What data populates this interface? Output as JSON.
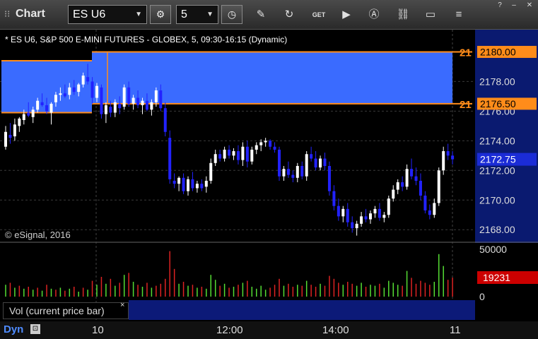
{
  "toolbar": {
    "title": "Chart",
    "symbol": "ES U6",
    "interval": "5"
  },
  "chart": {
    "header": "* ES U6, S&P 500 E-MINI FUTURES - GLOBEX, 5, 09:30-16:15 (Dynamic)",
    "copyright": "© eSignal, 2016",
    "price_labels": [
      "2178.00",
      "2176.00",
      "2174.00",
      "2172.00",
      "2170.00",
      "2168.00"
    ],
    "level_high": "2180.00",
    "level_low": "2176.50",
    "level_high_short": "21",
    "level_low_short": "21",
    "last_price": "2172.75",
    "volume_labels": [
      "50000",
      "0"
    ],
    "volume_current": "19231",
    "volume_title": "Vol (current price bar)",
    "volume_close": "×",
    "time_labels": [
      "10",
      "12:00",
      "14:00",
      "11"
    ],
    "footer_mode": "Dyn"
  },
  "colors": {
    "zone": "#3a6bff",
    "level": "#ff8c1a",
    "down_bar": "#2222ff",
    "up_bar": "#ffffff",
    "price_tag_bg": "#1b2cd6",
    "volume_tag_bg": "#cc0000",
    "vol_up": "#55dd33",
    "vol_down": "#dd2222"
  },
  "chart_data": {
    "type": "candlestick",
    "price_range": [
      2167.2,
      2181.5
    ],
    "volume_range": [
      0,
      50000
    ],
    "candles": [
      [
        2173.6,
        2175.0,
        2173.4,
        2174.6
      ],
      [
        2174.4,
        2175.2,
        2173.8,
        2174.2
      ],
      [
        2174.3,
        2175.5,
        2174.0,
        2175.1
      ],
      [
        2175.0,
        2175.6,
        2174.6,
        2175.5
      ],
      [
        2175.4,
        2176.1,
        2175.1,
        2175.8
      ],
      [
        2175.9,
        2176.6,
        2175.6,
        2175.7
      ],
      [
        2175.6,
        2176.3,
        2175.2,
        2176.1
      ],
      [
        2176.1,
        2176.9,
        2175.9,
        2176.7
      ],
      [
        2176.6,
        2177.2,
        2176.3,
        2176.4
      ],
      [
        2176.4,
        2176.9,
        2175.8,
        2176.0
      ],
      [
        2175.9,
        2176.6,
        2175.1,
        2176.5
      ],
      [
        2176.6,
        2177.3,
        2176.3,
        2177.1
      ],
      [
        2177.1,
        2177.6,
        2176.7,
        2177.2
      ],
      [
        2177.2,
        2177.8,
        2176.9,
        2177.0
      ],
      [
        2177.1,
        2177.9,
        2176.8,
        2177.6
      ],
      [
        2177.6,
        2178.1,
        2177.1,
        2177.3
      ],
      [
        2177.3,
        2177.9,
        2177.0,
        2177.8
      ],
      [
        2177.8,
        2178.6,
        2177.6,
        2178.4
      ],
      [
        2178.3,
        2179.2,
        2177.8,
        2178.0
      ],
      [
        2178.0,
        2178.3,
        2176.5,
        2176.9
      ],
      [
        2176.9,
        2177.9,
        2176.6,
        2177.7
      ],
      [
        2177.6,
        2177.8,
        2175.5,
        2175.8
      ],
      [
        2175.8,
        2176.6,
        2175.2,
        2176.4
      ],
      [
        2176.3,
        2176.7,
        2175.6,
        2175.9
      ],
      [
        2175.9,
        2176.8,
        2175.6,
        2176.6
      ],
      [
        2176.5,
        2177.0,
        2175.8,
        2176.2
      ],
      [
        2176.3,
        2177.8,
        2176.1,
        2177.6
      ],
      [
        2177.6,
        2178.0,
        2176.3,
        2176.5
      ],
      [
        2176.5,
        2177.1,
        2176.1,
        2176.9
      ],
      [
        2176.9,
        2177.4,
        2176.2,
        2176.4
      ],
      [
        2176.4,
        2176.9,
        2175.8,
        2176.7
      ],
      [
        2176.7,
        2177.2,
        2176.0,
        2176.1
      ],
      [
        2176.1,
        2176.8,
        2175.7,
        2176.6
      ],
      [
        2176.6,
        2177.6,
        2176.3,
        2177.4
      ],
      [
        2177.4,
        2177.8,
        2176.0,
        2176.2
      ],
      [
        2176.2,
        2176.6,
        2174.3,
        2174.6
      ],
      [
        2174.2,
        2174.7,
        2171.1,
        2171.4
      ],
      [
        2171.3,
        2171.8,
        2170.8,
        2171.1
      ],
      [
        2171.1,
        2171.6,
        2170.6,
        2171.5
      ],
      [
        2171.5,
        2171.8,
        2170.4,
        2170.6
      ],
      [
        2170.6,
        2171.6,
        2170.3,
        2171.4
      ],
      [
        2171.4,
        2171.9,
        2170.6,
        2170.8
      ],
      [
        2170.8,
        2171.3,
        2170.5,
        2171.1
      ],
      [
        2171.1,
        2171.4,
        2170.6,
        2170.8
      ],
      [
        2170.9,
        2171.6,
        2170.5,
        2171.3
      ],
      [
        2171.3,
        2172.8,
        2171.1,
        2172.5
      ],
      [
        2172.5,
        2173.4,
        2172.3,
        2173.1
      ],
      [
        2173.1,
        2173.4,
        2172.6,
        2172.8
      ],
      [
        2172.8,
        2173.6,
        2172.6,
        2173.4
      ],
      [
        2173.4,
        2173.7,
        2172.8,
        2173.0
      ],
      [
        2173.0,
        2173.5,
        2172.7,
        2173.3
      ],
      [
        2173.3,
        2173.7,
        2172.4,
        2172.7
      ],
      [
        2172.7,
        2173.9,
        2172.3,
        2173.6
      ],
      [
        2173.6,
        2174.0,
        2172.2,
        2172.6
      ],
      [
        2172.6,
        2173.6,
        2172.4,
        2173.4
      ],
      [
        2173.4,
        2173.9,
        2173.1,
        2173.7
      ],
      [
        2173.7,
        2174.1,
        2173.3,
        2173.9
      ],
      [
        2173.9,
        2174.2,
        2173.6,
        2174.0
      ],
      [
        2174.0,
        2174.1,
        2173.4,
        2173.6
      ],
      [
        2173.6,
        2173.9,
        2173.2,
        2173.4
      ],
      [
        2173.4,
        2173.6,
        2171.3,
        2171.6
      ],
      [
        2171.6,
        2172.3,
        2171.3,
        2172.1
      ],
      [
        2172.1,
        2172.6,
        2171.5,
        2171.7
      ],
      [
        2171.7,
        2172.0,
        2171.2,
        2171.5
      ],
      [
        2171.5,
        2172.5,
        2171.2,
        2172.3
      ],
      [
        2172.3,
        2172.6,
        2171.4,
        2171.6
      ],
      [
        2171.6,
        2173.3,
        2171.3,
        2173.1
      ],
      [
        2173.1,
        2173.6,
        2172.6,
        2172.8
      ],
      [
        2172.8,
        2173.3,
        2172.0,
        2172.2
      ],
      [
        2172.2,
        2173.0,
        2172.0,
        2172.8
      ],
      [
        2172.8,
        2173.2,
        2172.0,
        2172.3
      ],
      [
        2172.3,
        2172.6,
        2170.3,
        2170.6
      ],
      [
        2170.6,
        2171.0,
        2169.3,
        2169.6
      ],
      [
        2169.6,
        2170.1,
        2168.6,
        2168.9
      ],
      [
        2168.9,
        2169.6,
        2168.5,
        2169.4
      ],
      [
        2169.4,
        2169.8,
        2168.2,
        2168.5
      ],
      [
        2168.5,
        2168.9,
        2167.8,
        2168.1
      ],
      [
        2168.1,
        2168.6,
        2167.6,
        2168.4
      ],
      [
        2168.4,
        2169.2,
        2168.2,
        2168.9
      ],
      [
        2168.9,
        2169.4,
        2168.5,
        2168.7
      ],
      [
        2168.7,
        2169.3,
        2168.4,
        2169.1
      ],
      [
        2169.1,
        2169.6,
        2168.8,
        2169.4
      ],
      [
        2169.4,
        2169.8,
        2168.6,
        2168.8
      ],
      [
        2168.8,
        2169.2,
        2168.5,
        2169.0
      ],
      [
        2169.0,
        2170.3,
        2168.8,
        2170.1
      ],
      [
        2170.1,
        2171.0,
        2169.9,
        2170.7
      ],
      [
        2170.7,
        2171.4,
        2170.4,
        2171.2
      ],
      [
        2171.2,
        2171.6,
        2170.6,
        2170.9
      ],
      [
        2170.9,
        2172.4,
        2170.7,
        2172.1
      ],
      [
        2172.1,
        2172.8,
        2171.4,
        2171.6
      ],
      [
        2171.6,
        2172.2,
        2171.0,
        2171.3
      ],
      [
        2171.3,
        2171.8,
        2170.0,
        2170.3
      ],
      [
        2170.3,
        2170.6,
        2169.1,
        2169.3
      ],
      [
        2169.3,
        2169.7,
        2168.7,
        2169.0
      ],
      [
        2169.0,
        2170.1,
        2168.8,
        2169.8
      ],
      [
        2169.8,
        2172.2,
        2169.6,
        2172.0
      ],
      [
        2172.0,
        2173.6,
        2171.7,
        2173.3
      ],
      [
        2173.3,
        2173.8,
        2172.7,
        2173.0
      ],
      [
        2173.0,
        2173.3,
        2172.4,
        2172.75
      ]
    ],
    "volumes": [
      [
        12000,
        1
      ],
      [
        14000,
        0
      ],
      [
        9000,
        1
      ],
      [
        11000,
        0
      ],
      [
        8000,
        1
      ],
      [
        10000,
        0
      ],
      [
        7000,
        1
      ],
      [
        9000,
        0
      ],
      [
        6000,
        1
      ],
      [
        12000,
        0
      ],
      [
        8000,
        1
      ],
      [
        7000,
        0
      ],
      [
        9000,
        1
      ],
      [
        6000,
        0
      ],
      [
        8000,
        1
      ],
      [
        10000,
        0
      ],
      [
        5000,
        1
      ],
      [
        9000,
        0
      ],
      [
        7000,
        1
      ],
      [
        16000,
        0
      ],
      [
        12000,
        1
      ],
      [
        20000,
        0
      ],
      [
        13000,
        1
      ],
      [
        18000,
        0
      ],
      [
        11000,
        1
      ],
      [
        14000,
        0
      ],
      [
        22000,
        1
      ],
      [
        24000,
        0
      ],
      [
        15000,
        1
      ],
      [
        12000,
        0
      ],
      [
        10000,
        1
      ],
      [
        14000,
        0
      ],
      [
        9000,
        1
      ],
      [
        11000,
        0
      ],
      [
        13000,
        0
      ],
      [
        18000,
        0
      ],
      [
        46000,
        0
      ],
      [
        28000,
        0
      ],
      [
        13000,
        1
      ],
      [
        15000,
        0
      ],
      [
        11000,
        1
      ],
      [
        12000,
        0
      ],
      [
        9000,
        1
      ],
      [
        10000,
        0
      ],
      [
        8000,
        1
      ],
      [
        22000,
        1
      ],
      [
        17000,
        1
      ],
      [
        11000,
        0
      ],
      [
        13000,
        1
      ],
      [
        9000,
        0
      ],
      [
        10000,
        1
      ],
      [
        12000,
        0
      ],
      [
        14000,
        1
      ],
      [
        16000,
        0
      ],
      [
        10000,
        1
      ],
      [
        8000,
        1
      ],
      [
        11000,
        1
      ],
      [
        7000,
        1
      ],
      [
        9000,
        0
      ],
      [
        12000,
        0
      ],
      [
        18000,
        0
      ],
      [
        11000,
        1
      ],
      [
        13000,
        0
      ],
      [
        10000,
        0
      ],
      [
        12000,
        1
      ],
      [
        11000,
        0
      ],
      [
        16000,
        1
      ],
      [
        12000,
        0
      ],
      [
        10000,
        0
      ],
      [
        13000,
        1
      ],
      [
        11000,
        0
      ],
      [
        21000,
        0
      ],
      [
        18000,
        0
      ],
      [
        14000,
        0
      ],
      [
        12000,
        1
      ],
      [
        15000,
        0
      ],
      [
        13000,
        0
      ],
      [
        11000,
        1
      ],
      [
        14000,
        1
      ],
      [
        10000,
        0
      ],
      [
        12000,
        1
      ],
      [
        11000,
        1
      ],
      [
        13000,
        0
      ],
      [
        9000,
        1
      ],
      [
        16000,
        1
      ],
      [
        14000,
        1
      ],
      [
        12000,
        1
      ],
      [
        11000,
        0
      ],
      [
        26000,
        1
      ],
      [
        19000,
        0
      ],
      [
        13000,
        0
      ],
      [
        16000,
        0
      ],
      [
        14000,
        0
      ],
      [
        12000,
        0
      ],
      [
        15000,
        1
      ],
      [
        43000,
        1
      ],
      [
        31000,
        1
      ],
      [
        17000,
        0
      ],
      [
        19231,
        0
      ]
    ]
  }
}
